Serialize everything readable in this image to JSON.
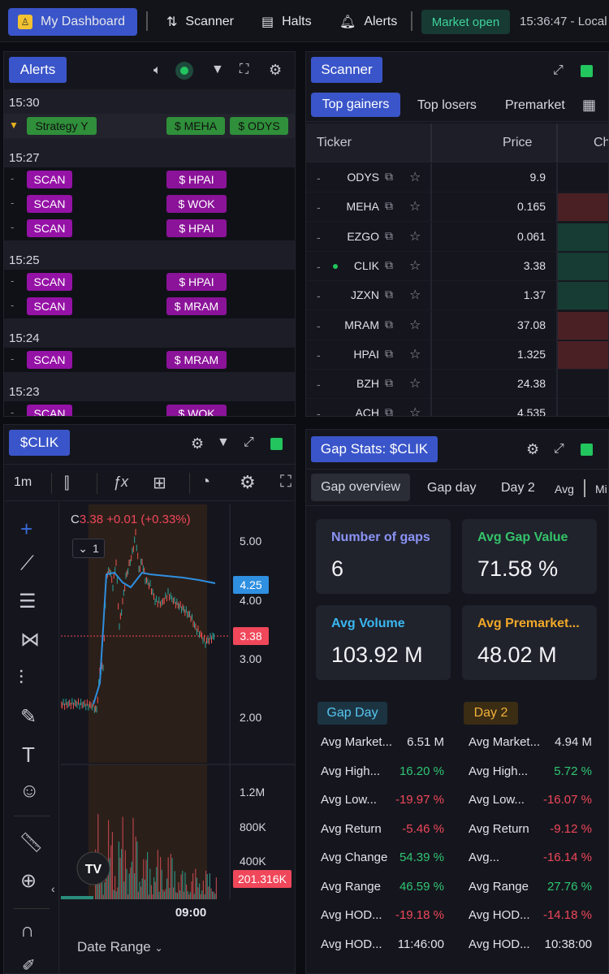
{
  "topbar": {
    "dashboard": "My Dashboard",
    "scanner": "Scanner",
    "halts": "Halts",
    "alerts": "Alerts",
    "market": "Market open",
    "time": "15:36:47 - Local"
  },
  "alerts": {
    "title": "Alerts",
    "groups": [
      {
        "time": "15:30",
        "rows": [
          {
            "label": "Strategy Y",
            "tickers": [
              "$ MEHA",
              "$ ODYS"
            ]
          }
        ]
      },
      {
        "time": "15:27",
        "rows": [
          {
            "label": "SCAN",
            "tickers": [
              "$ HPAI"
            ]
          },
          {
            "label": "SCAN",
            "tickers": [
              "$ WOK"
            ]
          },
          {
            "label": "SCAN",
            "tickers": [
              "$ HPAI"
            ]
          }
        ]
      },
      {
        "time": "15:25",
        "rows": [
          {
            "label": "SCAN",
            "tickers": [
              "$ HPAI"
            ]
          },
          {
            "label": "SCAN",
            "tickers": [
              "$ MRAM"
            ]
          }
        ]
      },
      {
        "time": "15:24",
        "rows": [
          {
            "label": "SCAN",
            "tickers": [
              "$ MRAM"
            ]
          }
        ]
      },
      {
        "time": "15:23",
        "rows": [
          {
            "label": "SCAN",
            "tickers": [
              "$ WOK"
            ]
          }
        ]
      }
    ]
  },
  "scanner": {
    "title": "Scanner",
    "tabs": [
      "Top gainers",
      "Top losers",
      "Premarket"
    ],
    "columns": [
      "Ticker",
      "Price",
      "Ch"
    ],
    "rows": [
      {
        "t": "ODYS",
        "p": "9.9",
        "c": ""
      },
      {
        "t": "MEHA",
        "p": "0.165",
        "c": "neg"
      },
      {
        "t": "EZGO",
        "p": "0.061",
        "c": "pos"
      },
      {
        "t": "CLIK",
        "p": "3.38",
        "c": "pos",
        "dot": true
      },
      {
        "t": "JZXN",
        "p": "1.37",
        "c": "pos"
      },
      {
        "t": "MRAM",
        "p": "37.08",
        "c": "neg"
      },
      {
        "t": "HPAI",
        "p": "1.325",
        "c": "neg"
      },
      {
        "t": "BZH",
        "p": "24.38",
        "c": ""
      },
      {
        "t": "ACH",
        "p": "4.535",
        "c": ""
      }
    ]
  },
  "chart": {
    "title": "$CLIK",
    "interval": "1m",
    "ohlc_prefix": "C",
    "ohlc_close": "3.38",
    "ohlc_change": "+0.01 (+0.33%)",
    "panes": "1",
    "price_ticks": [
      "5.00",
      "4.00",
      "3.00",
      "2.00"
    ],
    "vwap_label": "4.25",
    "last_label": "3.38",
    "vol_ticks": [
      "1.2M",
      "800K",
      "400K"
    ],
    "vol_label": "201.316K",
    "time_tick": "09:00",
    "date_range": "Date Range",
    "colors": {
      "vwap": "#2f8fe0",
      "last": "#f0475a",
      "up": "#26a69a",
      "down": "#ef5350"
    }
  },
  "gap": {
    "title": "Gap Stats: $CLIK",
    "tabs": [
      "Gap overview",
      "Gap day",
      "Day 2",
      "Avg",
      "Mi"
    ],
    "cards": [
      {
        "label": "Number of gaps",
        "value": "6",
        "color": "#8b93f5"
      },
      {
        "label": "Avg Gap Value",
        "value": "71.58 %",
        "color": "#33c46a"
      },
      {
        "label": "Avg Volume",
        "value": "103.92 M",
        "color": "#3ab7f0"
      },
      {
        "label": "Avg Premarket...",
        "value": "48.02 M",
        "color": "#f0a828"
      }
    ],
    "gapday": {
      "title": "Gap Day",
      "rows": [
        {
          "l": "Avg Market...",
          "v": "6.51 M",
          "c": ""
        },
        {
          "l": "Avg High...",
          "v": "16.20 %",
          "c": "pos"
        },
        {
          "l": "Avg Low...",
          "v": "-19.97 %",
          "c": "neg"
        },
        {
          "l": "Avg Return",
          "v": "-5.46 %",
          "c": "neg"
        },
        {
          "l": "Avg Change",
          "v": "54.39 %",
          "c": "pos"
        },
        {
          "l": "Avg Range",
          "v": "46.59 %",
          "c": "pos"
        },
        {
          "l": "Avg HOD...",
          "v": "-19.18 %",
          "c": "neg"
        },
        {
          "l": "Avg HOD...",
          "v": "11:46:00",
          "c": ""
        }
      ]
    },
    "day2": {
      "title": "Day 2",
      "rows": [
        {
          "l": "Avg Market...",
          "v": "4.94 M",
          "c": ""
        },
        {
          "l": "Avg High...",
          "v": "5.72 %",
          "c": "pos"
        },
        {
          "l": "Avg Low...",
          "v": "-16.07 %",
          "c": "neg"
        },
        {
          "l": "Avg Return",
          "v": "-9.12 %",
          "c": "neg"
        },
        {
          "l": "Avg...",
          "v": "-16.14 %",
          "c": "neg"
        },
        {
          "l": "Avg Range",
          "v": "27.76 %",
          "c": "pos"
        },
        {
          "l": "Avg HOD...",
          "v": "-14.18 %",
          "c": "neg"
        },
        {
          "l": "Avg HOD...",
          "v": "10:38:00",
          "c": ""
        }
      ]
    }
  }
}
